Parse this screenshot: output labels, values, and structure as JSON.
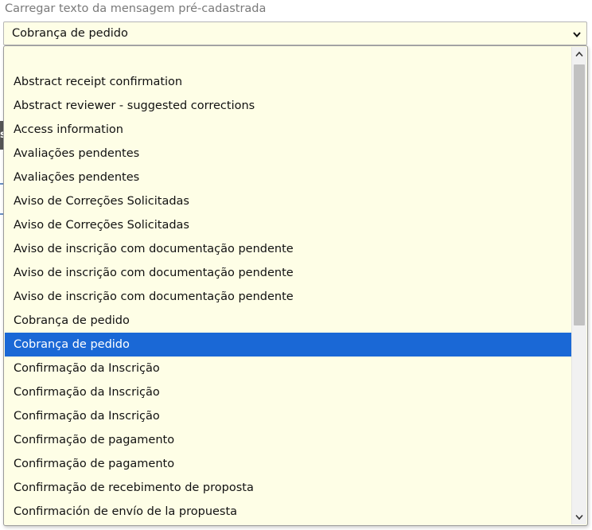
{
  "field": {
    "label": "Carregar texto da mensagem pré-cadastrada",
    "selected_value": "Cobrança de pedido"
  },
  "dropdown": {
    "options": [
      "",
      "Abstract receipt confirmation",
      "Abstract reviewer - suggested corrections",
      "Access information",
      "Avaliações pendentes",
      "Avaliações pendentes",
      "Aviso de Correções Solicitadas",
      "Aviso de Correções Solicitadas",
      "Aviso de inscrição com documentação pendente",
      "Aviso de inscrição com documentação pendente",
      "Aviso de inscrição com documentação pendente",
      "Cobrança de pedido",
      "Cobrança de pedido",
      "Confirmação da Inscrição",
      "Confirmação da Inscrição",
      "Confirmação da Inscrição",
      "Confirmação de pagamento",
      "Confirmação de pagamento",
      "Confirmação de recebimento de proposta",
      "Confirmación de envío de la propuesta"
    ],
    "highlighted_index": 12
  },
  "colors": {
    "highlight": "#1a68d6",
    "dropdown_bg": "#fefee6",
    "label": "#7a7a7a"
  }
}
